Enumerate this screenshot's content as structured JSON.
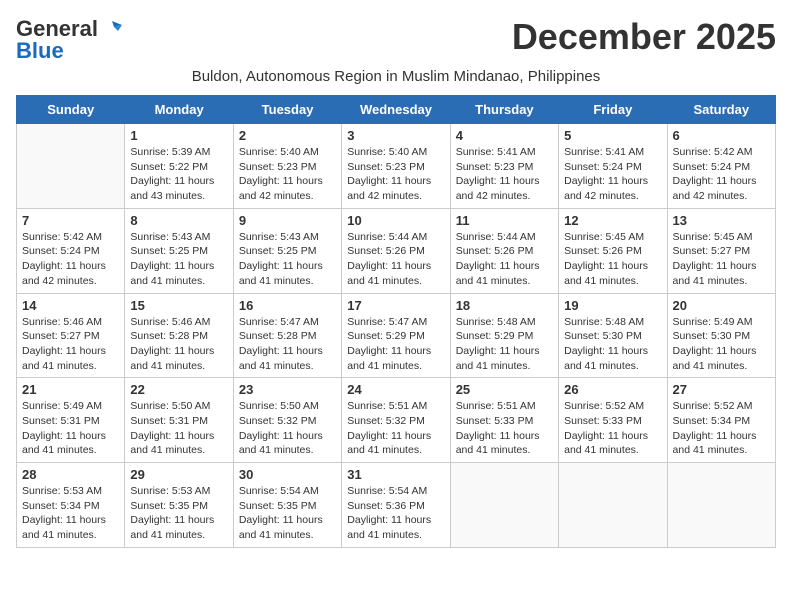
{
  "header": {
    "logo_general": "General",
    "logo_blue": "Blue",
    "month_title": "December 2025",
    "subtitle": "Buldon, Autonomous Region in Muslim Mindanao, Philippines"
  },
  "calendar": {
    "weekdays": [
      "Sunday",
      "Monday",
      "Tuesday",
      "Wednesday",
      "Thursday",
      "Friday",
      "Saturday"
    ],
    "weeks": [
      [
        {
          "day": "",
          "sunrise": "",
          "sunset": "",
          "daylight": ""
        },
        {
          "day": "1",
          "sunrise": "Sunrise: 5:39 AM",
          "sunset": "Sunset: 5:22 PM",
          "daylight": "Daylight: 11 hours and 43 minutes."
        },
        {
          "day": "2",
          "sunrise": "Sunrise: 5:40 AM",
          "sunset": "Sunset: 5:23 PM",
          "daylight": "Daylight: 11 hours and 42 minutes."
        },
        {
          "day": "3",
          "sunrise": "Sunrise: 5:40 AM",
          "sunset": "Sunset: 5:23 PM",
          "daylight": "Daylight: 11 hours and 42 minutes."
        },
        {
          "day": "4",
          "sunrise": "Sunrise: 5:41 AM",
          "sunset": "Sunset: 5:23 PM",
          "daylight": "Daylight: 11 hours and 42 minutes."
        },
        {
          "day": "5",
          "sunrise": "Sunrise: 5:41 AM",
          "sunset": "Sunset: 5:24 PM",
          "daylight": "Daylight: 11 hours and 42 minutes."
        },
        {
          "day": "6",
          "sunrise": "Sunrise: 5:42 AM",
          "sunset": "Sunset: 5:24 PM",
          "daylight": "Daylight: 11 hours and 42 minutes."
        }
      ],
      [
        {
          "day": "7",
          "sunrise": "Sunrise: 5:42 AM",
          "sunset": "Sunset: 5:24 PM",
          "daylight": "Daylight: 11 hours and 42 minutes."
        },
        {
          "day": "8",
          "sunrise": "Sunrise: 5:43 AM",
          "sunset": "Sunset: 5:25 PM",
          "daylight": "Daylight: 11 hours and 41 minutes."
        },
        {
          "day": "9",
          "sunrise": "Sunrise: 5:43 AM",
          "sunset": "Sunset: 5:25 PM",
          "daylight": "Daylight: 11 hours and 41 minutes."
        },
        {
          "day": "10",
          "sunrise": "Sunrise: 5:44 AM",
          "sunset": "Sunset: 5:26 PM",
          "daylight": "Daylight: 11 hours and 41 minutes."
        },
        {
          "day": "11",
          "sunrise": "Sunrise: 5:44 AM",
          "sunset": "Sunset: 5:26 PM",
          "daylight": "Daylight: 11 hours and 41 minutes."
        },
        {
          "day": "12",
          "sunrise": "Sunrise: 5:45 AM",
          "sunset": "Sunset: 5:26 PM",
          "daylight": "Daylight: 11 hours and 41 minutes."
        },
        {
          "day": "13",
          "sunrise": "Sunrise: 5:45 AM",
          "sunset": "Sunset: 5:27 PM",
          "daylight": "Daylight: 11 hours and 41 minutes."
        }
      ],
      [
        {
          "day": "14",
          "sunrise": "Sunrise: 5:46 AM",
          "sunset": "Sunset: 5:27 PM",
          "daylight": "Daylight: 11 hours and 41 minutes."
        },
        {
          "day": "15",
          "sunrise": "Sunrise: 5:46 AM",
          "sunset": "Sunset: 5:28 PM",
          "daylight": "Daylight: 11 hours and 41 minutes."
        },
        {
          "day": "16",
          "sunrise": "Sunrise: 5:47 AM",
          "sunset": "Sunset: 5:28 PM",
          "daylight": "Daylight: 11 hours and 41 minutes."
        },
        {
          "day": "17",
          "sunrise": "Sunrise: 5:47 AM",
          "sunset": "Sunset: 5:29 PM",
          "daylight": "Daylight: 11 hours and 41 minutes."
        },
        {
          "day": "18",
          "sunrise": "Sunrise: 5:48 AM",
          "sunset": "Sunset: 5:29 PM",
          "daylight": "Daylight: 11 hours and 41 minutes."
        },
        {
          "day": "19",
          "sunrise": "Sunrise: 5:48 AM",
          "sunset": "Sunset: 5:30 PM",
          "daylight": "Daylight: 11 hours and 41 minutes."
        },
        {
          "day": "20",
          "sunrise": "Sunrise: 5:49 AM",
          "sunset": "Sunset: 5:30 PM",
          "daylight": "Daylight: 11 hours and 41 minutes."
        }
      ],
      [
        {
          "day": "21",
          "sunrise": "Sunrise: 5:49 AM",
          "sunset": "Sunset: 5:31 PM",
          "daylight": "Daylight: 11 hours and 41 minutes."
        },
        {
          "day": "22",
          "sunrise": "Sunrise: 5:50 AM",
          "sunset": "Sunset: 5:31 PM",
          "daylight": "Daylight: 11 hours and 41 minutes."
        },
        {
          "day": "23",
          "sunrise": "Sunrise: 5:50 AM",
          "sunset": "Sunset: 5:32 PM",
          "daylight": "Daylight: 11 hours and 41 minutes."
        },
        {
          "day": "24",
          "sunrise": "Sunrise: 5:51 AM",
          "sunset": "Sunset: 5:32 PM",
          "daylight": "Daylight: 11 hours and 41 minutes."
        },
        {
          "day": "25",
          "sunrise": "Sunrise: 5:51 AM",
          "sunset": "Sunset: 5:33 PM",
          "daylight": "Daylight: 11 hours and 41 minutes."
        },
        {
          "day": "26",
          "sunrise": "Sunrise: 5:52 AM",
          "sunset": "Sunset: 5:33 PM",
          "daylight": "Daylight: 11 hours and 41 minutes."
        },
        {
          "day": "27",
          "sunrise": "Sunrise: 5:52 AM",
          "sunset": "Sunset: 5:34 PM",
          "daylight": "Daylight: 11 hours and 41 minutes."
        }
      ],
      [
        {
          "day": "28",
          "sunrise": "Sunrise: 5:53 AM",
          "sunset": "Sunset: 5:34 PM",
          "daylight": "Daylight: 11 hours and 41 minutes."
        },
        {
          "day": "29",
          "sunrise": "Sunrise: 5:53 AM",
          "sunset": "Sunset: 5:35 PM",
          "daylight": "Daylight: 11 hours and 41 minutes."
        },
        {
          "day": "30",
          "sunrise": "Sunrise: 5:54 AM",
          "sunset": "Sunset: 5:35 PM",
          "daylight": "Daylight: 11 hours and 41 minutes."
        },
        {
          "day": "31",
          "sunrise": "Sunrise: 5:54 AM",
          "sunset": "Sunset: 5:36 PM",
          "daylight": "Daylight: 11 hours and 41 minutes."
        },
        {
          "day": "",
          "sunrise": "",
          "sunset": "",
          "daylight": ""
        },
        {
          "day": "",
          "sunrise": "",
          "sunset": "",
          "daylight": ""
        },
        {
          "day": "",
          "sunrise": "",
          "sunset": "",
          "daylight": ""
        }
      ]
    ]
  }
}
